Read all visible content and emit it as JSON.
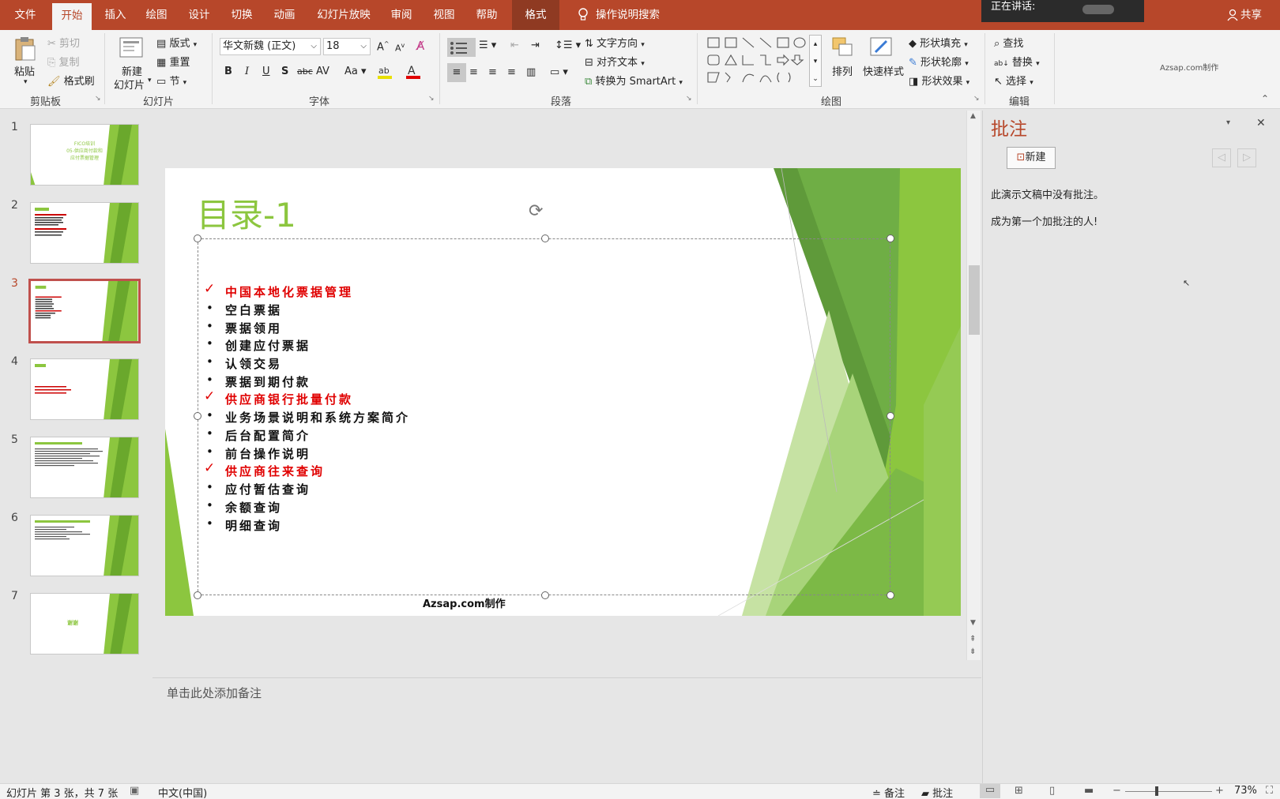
{
  "tabs": [
    "文件",
    "开始",
    "插入",
    "绘图",
    "设计",
    "切换",
    "动画",
    "幻灯片放映",
    "审阅",
    "视图",
    "帮助",
    "格式"
  ],
  "search_label": "操作说明搜索",
  "speaking_label": "正在讲话:",
  "share_label": "共享",
  "ribbon": {
    "clipboard": {
      "paste": "粘贴",
      "cut": "剪切",
      "copy": "复制",
      "format_painter": "格式刷",
      "group": "剪贴板"
    },
    "slides": {
      "new_slide_1": "新建",
      "new_slide_2": "幻灯片",
      "layout": "版式",
      "reset": "重置",
      "section": "节",
      "group": "幻灯片"
    },
    "font": {
      "family": "华文新魏 (正文)",
      "size": "18",
      "group": "字体"
    },
    "paragraph": {
      "text_direction": "文字方向",
      "align_text": "对齐文本",
      "smartart": "转换为 SmartArt",
      "group": "段落"
    },
    "drawing": {
      "arrange": "排列",
      "quick_styles": "快速样式",
      "fill": "形状填充",
      "outline": "形状轮廓",
      "effects": "形状效果",
      "group": "绘图"
    },
    "editing": {
      "find": "查找",
      "replace": "替换",
      "select": "选择",
      "group": "编辑"
    },
    "watermark": "Azsap.com制作"
  },
  "thumbs": [
    "1",
    "2",
    "3",
    "4",
    "5",
    "6",
    "7"
  ],
  "thumb_texts": {
    "t1a": "FICO培训",
    "t1b": "05-供应商付款和",
    "t1c": "应付票据管理",
    "t7": "谢谢"
  },
  "slide": {
    "title": "目录-1",
    "items": [
      {
        "text": "中国本地化票据管理",
        "marker": "✓",
        "red": true
      },
      {
        "text": "空白票据",
        "marker": "•",
        "red": false
      },
      {
        "text": "票据领用",
        "marker": "•",
        "red": false
      },
      {
        "text": "创建应付票据",
        "marker": "•",
        "red": false
      },
      {
        "text": "认领交易",
        "marker": "•",
        "red": false
      },
      {
        "text": "票据到期付款",
        "marker": "•",
        "red": false
      },
      {
        "text": "供应商银行批量付款",
        "marker": "✓",
        "red": true
      },
      {
        "text": "业务场景说明和系统方案简介",
        "marker": "•",
        "red": false
      },
      {
        "text": "后台配置简介",
        "marker": "•",
        "red": false
      },
      {
        "text": "前台操作说明",
        "marker": "•",
        "red": false
      },
      {
        "text": "供应商往来查询",
        "marker": "✓",
        "red": true
      },
      {
        "text": "应付暂估查询",
        "marker": "•",
        "red": false
      },
      {
        "text": "余额查询",
        "marker": "•",
        "red": false
      },
      {
        "text": "明细查询",
        "marker": "•",
        "red": false
      }
    ],
    "footer": "Azsap.com制作"
  },
  "notes_placeholder": "单击此处添加备注",
  "comments": {
    "title": "批注",
    "new_button": "新建",
    "empty": "此演示文稿中没有批注。",
    "invite": "成为第一个加批注的人!"
  },
  "status": {
    "slide_info": "幻灯片 第 3 张，共 7 张",
    "language": "中文(中国)",
    "notes": "备注",
    "comments": "批注",
    "zoom": "73%"
  },
  "colors": {
    "accent": "#b7472a",
    "green": "#8cc63f",
    "red": "#e00000"
  }
}
